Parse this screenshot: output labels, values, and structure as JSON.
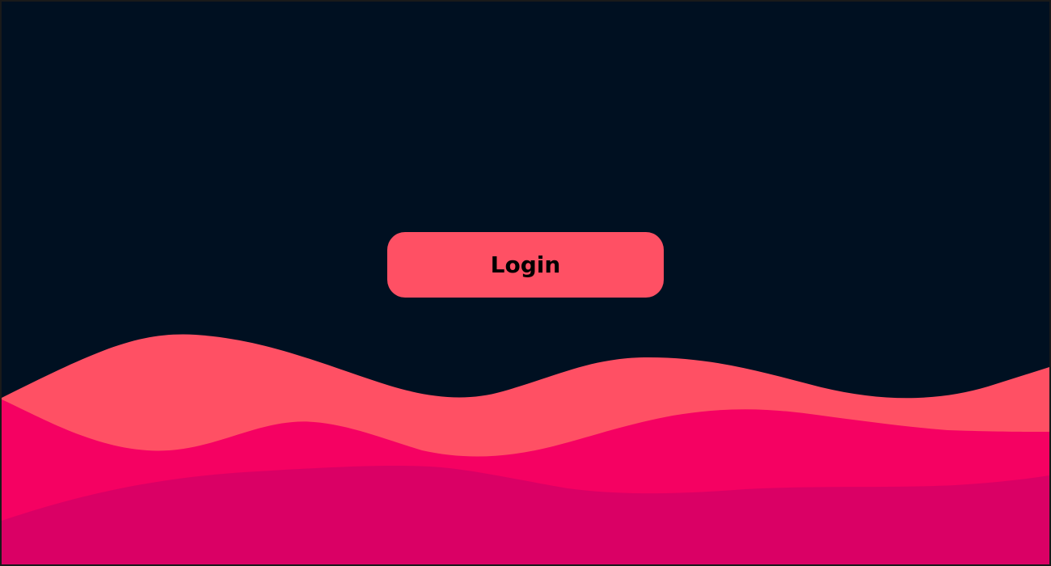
{
  "login_button": {
    "label": "Login"
  },
  "colors": {
    "background": "#001021",
    "button": "#FF5064",
    "wave_back": "#FF5064",
    "wave_middle": "#F50162",
    "wave_front": "#DA0065",
    "button_text": "#000000"
  }
}
